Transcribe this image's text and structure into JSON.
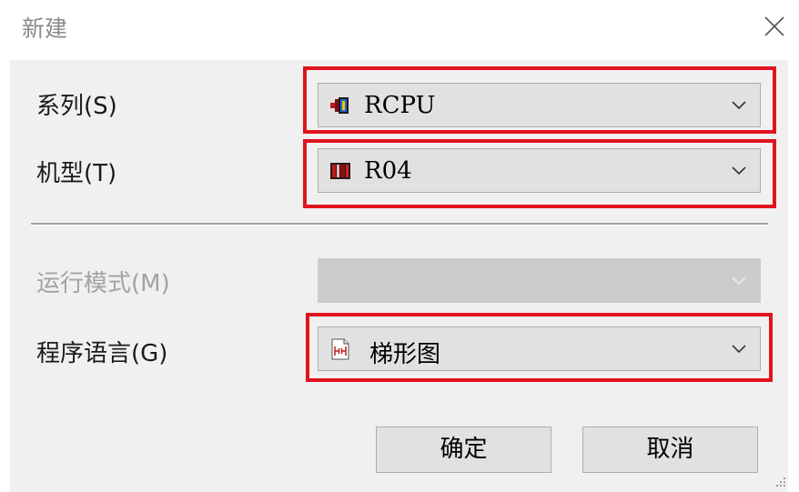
{
  "dialog": {
    "title": "新建",
    "close_icon": "close-icon"
  },
  "fields": {
    "series": {
      "label": "系列(S)",
      "value": "RCPU",
      "icon": "rcpu-series-icon"
    },
    "model": {
      "label": "机型(T)",
      "value": "R04",
      "icon": "cpu-model-icon"
    },
    "run_mode": {
      "label": "运行模式(M)",
      "value": "",
      "disabled": true
    },
    "program_language": {
      "label": "程序语言(G)",
      "value": "梯形图",
      "icon": "ladder-diagram-icon"
    }
  },
  "buttons": {
    "ok": "确定",
    "cancel": "取消"
  },
  "colors": {
    "highlight": "#e0141e",
    "dialog_bg": "#f0f0f0",
    "combo_bg": "#e1e1e1",
    "disabled_text": "#a3a3a3"
  }
}
